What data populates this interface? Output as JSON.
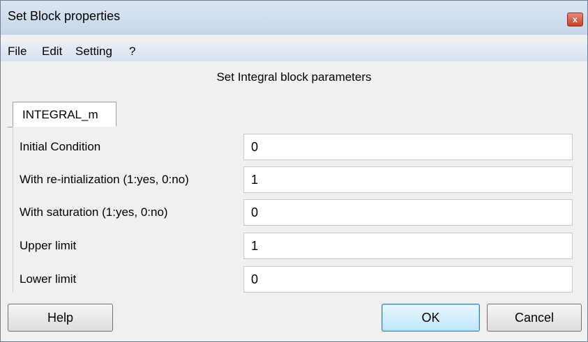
{
  "window": {
    "title": "Set Block properties",
    "close_glyph": "x"
  },
  "menu": {
    "items": [
      "File",
      "Edit",
      "Setting",
      "?"
    ]
  },
  "heading": "Set Integral block parameters",
  "tab": {
    "label": "INTEGRAL_m"
  },
  "params": [
    {
      "label": "Initial Condition",
      "value": "0"
    },
    {
      "label": "With re-intialization (1:yes, 0:no)",
      "value": "1"
    },
    {
      "label": "With saturation (1:yes, 0:no)",
      "value": "0"
    },
    {
      "label": "Upper limit",
      "value": "1"
    },
    {
      "label": "Lower limit",
      "value": "0"
    }
  ],
  "buttons": {
    "help": "Help",
    "ok": "OK",
    "cancel": "Cancel"
  }
}
